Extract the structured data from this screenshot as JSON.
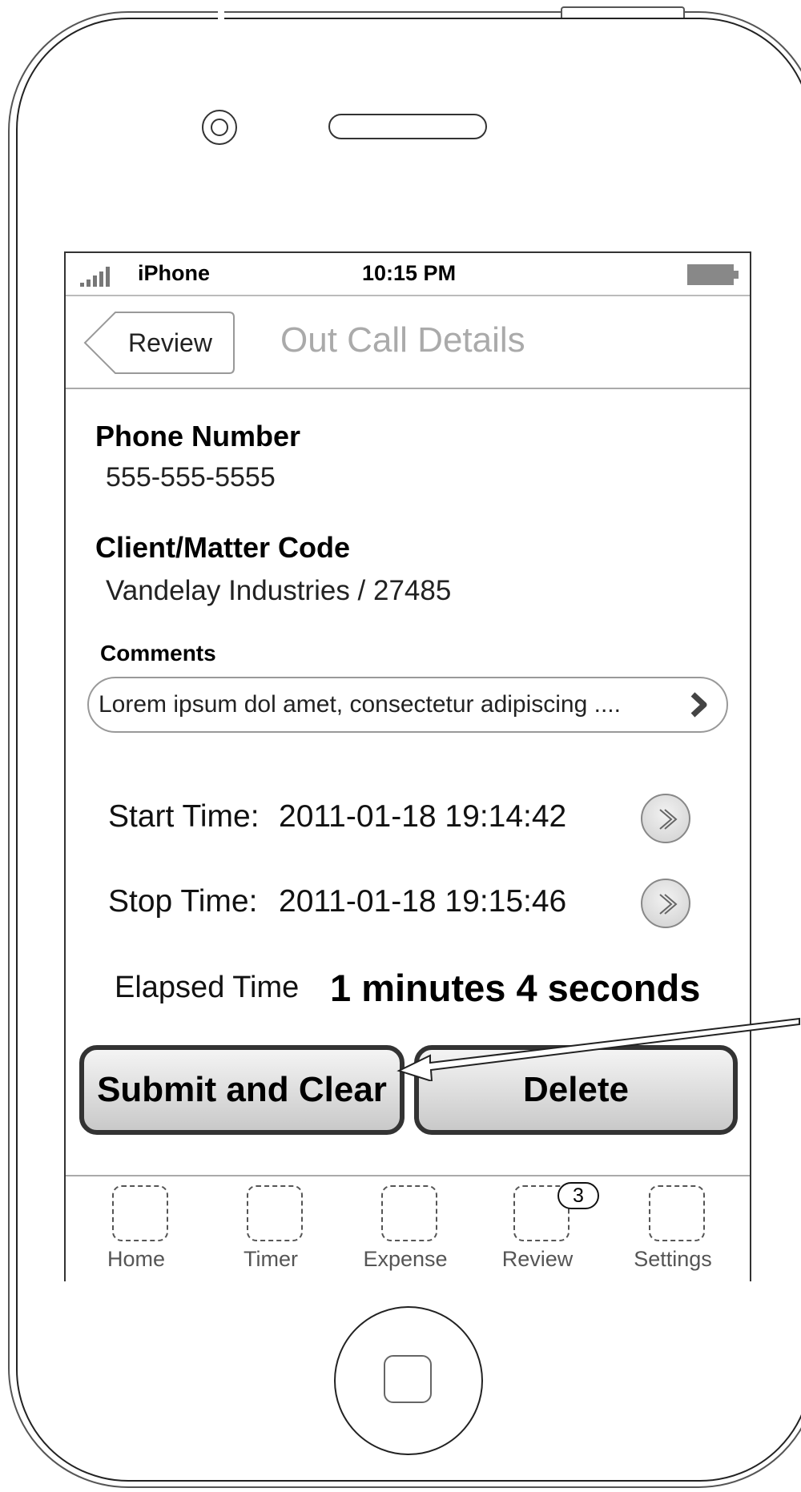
{
  "status_bar": {
    "carrier": "iPhone",
    "time": "10:15 PM"
  },
  "nav": {
    "back_label": "Review",
    "title": "Out Call Details"
  },
  "details": {
    "phone_label": "Phone Number",
    "phone_value": "555-555-5555",
    "client_label": "Client/Matter Code",
    "client_value": "Vandelay Industries / 27485",
    "comments_label": "Comments",
    "comments_value": "Lorem ipsum dol amet, consectetur adipiscing ...."
  },
  "times": {
    "start_label": "Start Time:",
    "start_value": "2011-01-18 19:14:42",
    "stop_label": "Stop Time:",
    "stop_value": "2011-01-18 19:15:46",
    "elapsed_label": "Elapsed Time",
    "elapsed_value": "1 minutes 4 seconds"
  },
  "actions": {
    "submit_label": "Submit and Clear",
    "delete_label": "Delete"
  },
  "tabs": [
    {
      "label": "Home",
      "icon": "home-icon"
    },
    {
      "label": "Timer",
      "icon": "timer-icon"
    },
    {
      "label": "Expense",
      "icon": "expense-icon"
    },
    {
      "label": "Review",
      "icon": "review-icon",
      "badge": "3"
    },
    {
      "label": "Settings",
      "icon": "settings-icon"
    }
  ]
}
